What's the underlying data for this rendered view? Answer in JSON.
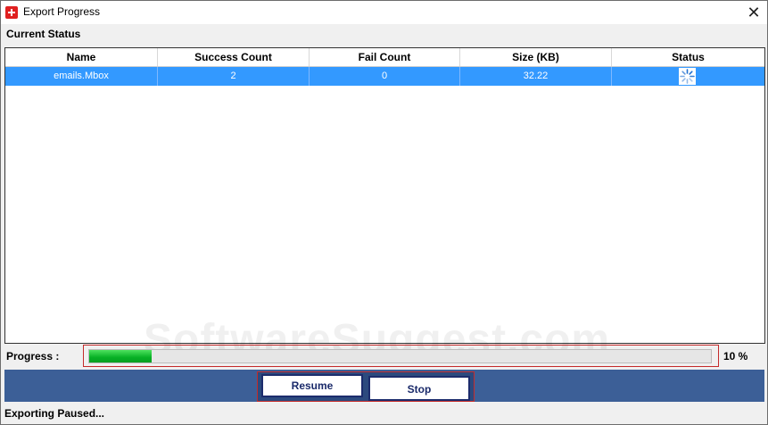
{
  "window": {
    "title": "Export Progress",
    "close_glyph": "✕"
  },
  "section": {
    "title": "Current Status"
  },
  "table": {
    "columns": [
      "Name",
      "Success Count",
      "Fail Count",
      "Size (KB)",
      "Status"
    ],
    "rows": [
      {
        "name": "emails.Mbox",
        "success": "2",
        "fail": "0",
        "size": "32.22",
        "status_icon": "loading-spinner-icon"
      }
    ]
  },
  "progress": {
    "label": "Progress :",
    "percent_text": "10 %",
    "value": 0.1,
    "bar_color": "#06b025"
  },
  "buttons": {
    "resume": "Resume",
    "stop": "Stop"
  },
  "status_bar": {
    "text": "Exporting Paused..."
  },
  "watermark": {
    "text": "SoftwareSuggest.com"
  },
  "colors": {
    "selection": "#3399ff",
    "button_bar": "#3c5f97",
    "accent_border": "#c42b2b"
  }
}
